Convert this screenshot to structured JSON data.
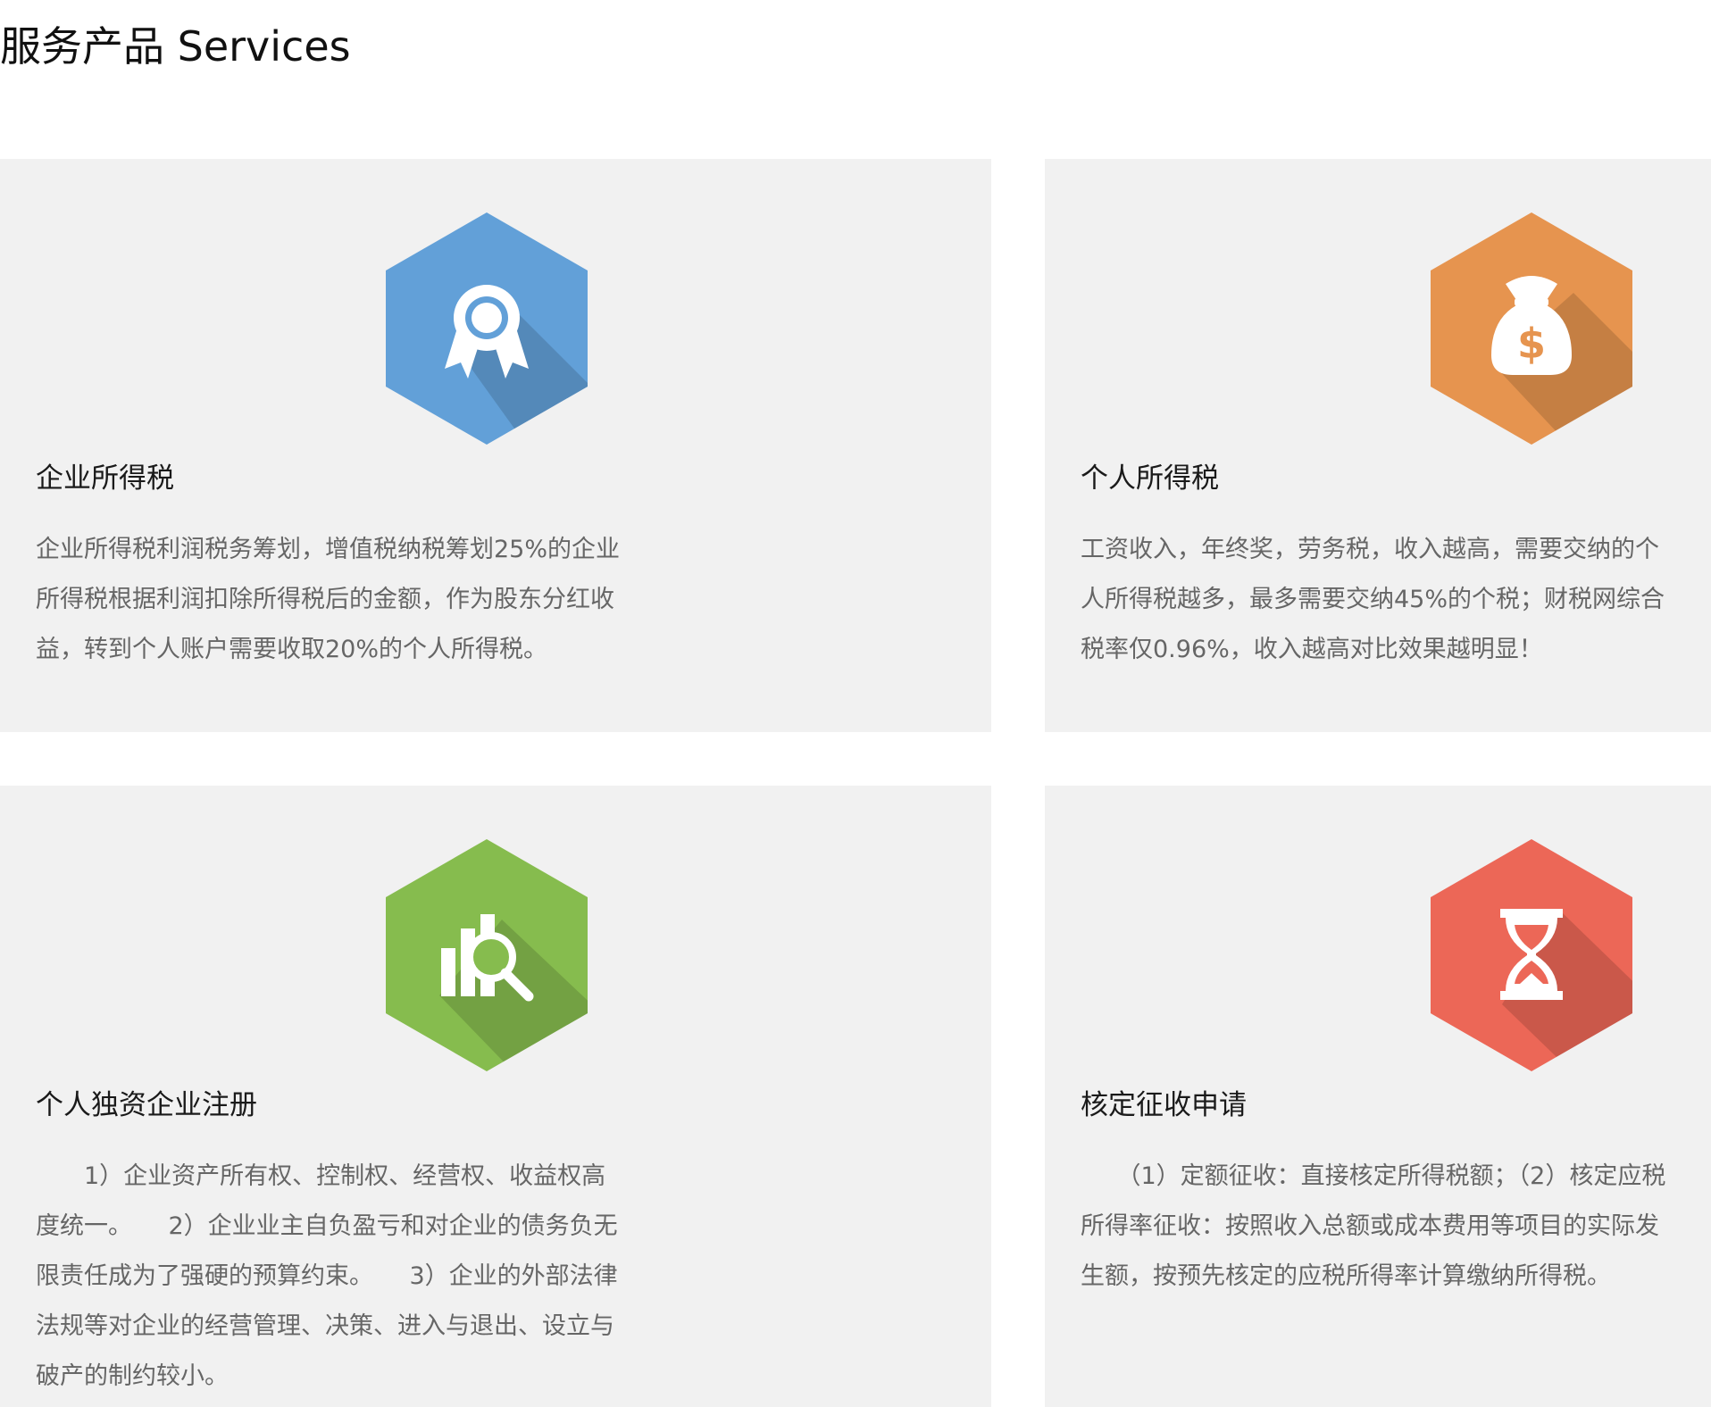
{
  "page": {
    "title": "服务产品 Services"
  },
  "colors": {
    "card_bg": "#f1f1f1",
    "blue": "#62a0d8",
    "orange": "#e6944f",
    "green": "#86bc4e",
    "red": "#ec6757"
  },
  "services": [
    {
      "title": "企业所得税",
      "icon": "award-ribbon-icon",
      "color": "#62a0d8",
      "description": "企业所得税利润税务筹划，增值税纳税筹划25%的企业所得税根据利润扣除所得税后的金额，作为股东分红收益，转到个人账户需要收取20%的个人所得税。"
    },
    {
      "title": "个人所得税",
      "icon": "money-bag-icon",
      "color": "#e6944f",
      "description": "工资收入，年终奖，劳务税，收入越高，需要交纳的个人所得税越多，最多需要交纳45%的个税；财税网综合税率仅0.96%，收入越高对比效果越明显！"
    },
    {
      "title": "个人独资企业注册",
      "icon": "chart-search-icon",
      "color": "#86bc4e",
      "description": "　　1）企业资产所有权、控制权、经营权、收益权高度统一。　　2）企业业主自负盈亏和对企业的债务负无限责任成为了强硬的预算约束。　　3）企业的外部法律法规等对企业的经营管理、决策、进入与退出、设立与破产的制约较小。"
    },
    {
      "title": "核定征收申请",
      "icon": "hourglass-icon",
      "color": "#ec6757",
      "description": "　　（1）定额征收：直接核定所得税额；（2）核定应税所得率征收：按照收入总额或成本费用等项目的实际发生额，按预先核定的应税所得率计算缴纳所得税。"
    }
  ]
}
